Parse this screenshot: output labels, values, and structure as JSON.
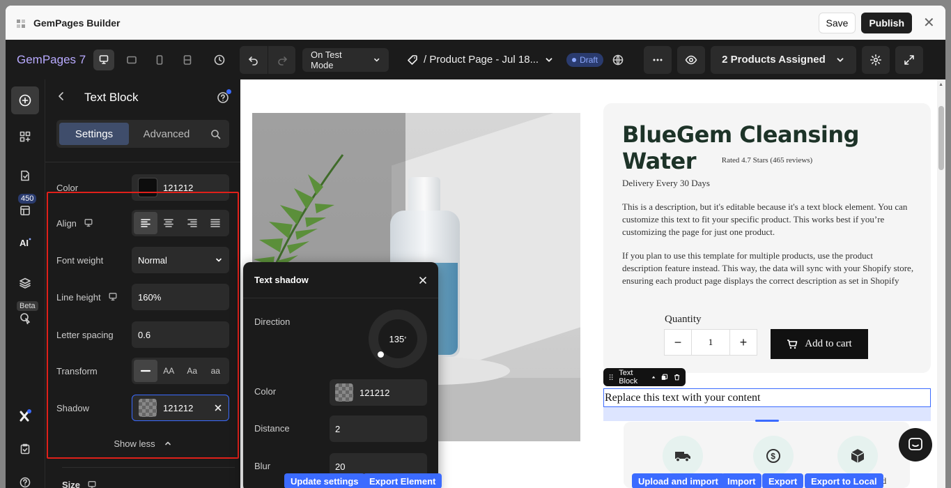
{
  "titlebar": {
    "title": "GemPages Builder",
    "save": "Save",
    "publish": "Publish"
  },
  "topbar": {
    "brand": "GemPages 7",
    "mode": "On Test Mode",
    "page_name": "/ Product Page - Jul 18...",
    "status": "Draft",
    "products": "2 Products Assigned"
  },
  "rail": {
    "badge_count": "450",
    "beta": "Beta"
  },
  "panel": {
    "title": "Text Block",
    "tabs": [
      "Settings",
      "Advanced"
    ],
    "color": {
      "label": "Color",
      "value": "121212"
    },
    "align": {
      "label": "Align"
    },
    "font_weight": {
      "label": "Font weight",
      "value": "Normal"
    },
    "line_height": {
      "label": "Line height",
      "value": "160%"
    },
    "letter_spacing": {
      "label": "Letter spacing",
      "value": "0.6"
    },
    "transform": {
      "label": "Transform",
      "options": [
        "AA",
        "Aa",
        "aa"
      ]
    },
    "shadow": {
      "label": "Shadow",
      "value": "121212"
    },
    "show_less": "Show less",
    "size": "Size"
  },
  "product": {
    "title": "BlueGem Cleansing Water",
    "rating": "Rated 4.7 Stars (465 reviews)",
    "delivery": "Delivery Every 30 Days",
    "desc1": "This is a description, but it's editable because it's a text block element. You can customize this text to fit your specific product. This works best if you’re customizing the page for just one product.",
    "desc2": "If you plan to use this template for multiple products, use the product description feature instead. This way, the data will sync with your Shopify store, ensuring each product page displays the correct description as set in Shopify",
    "quantity_label": "Quantity",
    "quantity": "1",
    "add_to_cart": "Add to cart"
  },
  "text_block": {
    "toolbar_label": "Text Block",
    "content": "Replace this text with your content"
  },
  "shadow_popup": {
    "title": "Text shadow",
    "direction_label": "Direction",
    "direction_value": "135",
    "direction_unit": "°",
    "color_label": "Color",
    "color_value": "121212",
    "distance_label": "Distance",
    "distance_value": "2",
    "blur_label": "Blur",
    "blur_value": "20"
  },
  "extension_buttons": [
    "Update settings",
    "Export Element",
    "Upload and import",
    "Import",
    "Export",
    "Export to Local"
  ],
  "feature_caption_fragment": "ed",
  "colors": {
    "accent": "#3b6bff",
    "highlight_border": "#e0201a",
    "brand": "#b8aaff",
    "title_green": "#1d3328"
  }
}
